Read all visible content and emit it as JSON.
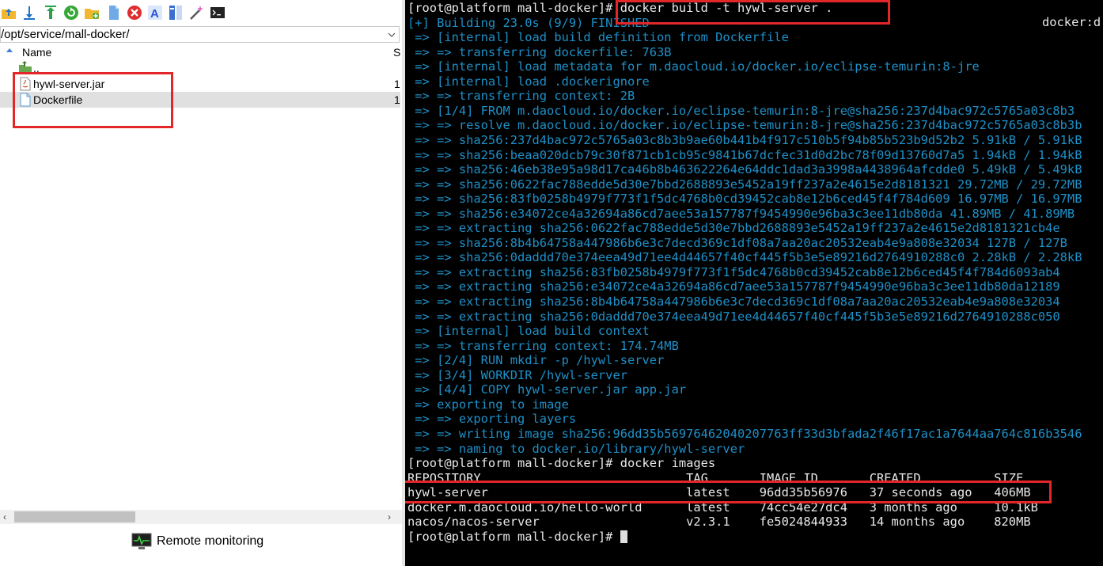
{
  "toolbar": {
    "icons": [
      "folder-up-icon",
      "download-icon",
      "upload-icon",
      "refresh-icon",
      "new-folder-icon",
      "new-file-icon",
      "delete-icon",
      "rename-icon",
      "properties-icon",
      "magic-wand-icon",
      "terminal-icon"
    ]
  },
  "file_panel": {
    "path": "/opt/service/mall-docker/",
    "columns": {
      "name": "Name",
      "size": "S"
    },
    "parent_entry": "..",
    "files": [
      {
        "name": "hywl-server.jar",
        "size": "1"
      },
      {
        "name": "Dockerfile",
        "size": "1"
      }
    ],
    "remote_monitoring_label": "Remote monitoring"
  },
  "terminal": {
    "top_right": "docker:d",
    "lines": [
      {
        "text": "[root@platform mall-docker]# docker build -t hywl-server .",
        "style": "w"
      },
      {
        "text": "[+] Building 23.0s (9/9) FINISHED",
        "style": "b"
      },
      {
        "text": " => [internal] load build definition from Dockerfile",
        "style": "b"
      },
      {
        "text": " => => transferring dockerfile: 763B",
        "style": "b"
      },
      {
        "text": " => [internal] load metadata for m.daocloud.io/docker.io/eclipse-temurin:8-jre",
        "style": "b"
      },
      {
        "text": " => [internal] load .dockerignore",
        "style": "b"
      },
      {
        "text": " => => transferring context: 2B",
        "style": "b"
      },
      {
        "text": " => [1/4] FROM m.daocloud.io/docker.io/eclipse-temurin:8-jre@sha256:237d4bac972c5765a03c8b3",
        "style": "b"
      },
      {
        "text": " => => resolve m.daocloud.io/docker.io/eclipse-temurin:8-jre@sha256:237d4bac972c5765a03c8b3b",
        "style": "b"
      },
      {
        "text": " => => sha256:237d4bac972c5765a03c8b3b9ae60b441b4f917c510b5f94b85b523b9d52b2 5.91kB / 5.91kB",
        "style": "b"
      },
      {
        "text": " => => sha256:beaa020dcb79c30f871cb1cb95c9841b67dcfec31d0d2bc78f09d13760d7a5 1.94kB / 1.94kB",
        "style": "b"
      },
      {
        "text": " => => sha256:46eb38e95a98d17ca46b8b463622264e64ddc1dad3a3998a4438964afcdde0 5.49kB / 5.49kB",
        "style": "b"
      },
      {
        "text": " => => sha256:0622fac788edde5d30e7bbd2688893e5452a19ff237a2e4615e2d8181321 29.72MB / 29.72MB",
        "style": "b"
      },
      {
        "text": " => => sha256:83fb0258b4979f773f1f5dc4768b0cd39452cab8e12b6ced45f4f784d609 16.97MB / 16.97MB",
        "style": "b"
      },
      {
        "text": " => => sha256:e34072ce4a32694a86cd7aee53a157787f9454990e96ba3c3ee11db80da 41.89MB / 41.89MB",
        "style": "b"
      },
      {
        "text": " => => extracting sha256:0622fac788edde5d30e7bbd2688893e5452a19ff237a2e4615e2d8181321cb4e",
        "style": "b"
      },
      {
        "text": " => => sha256:8b4b64758a447986b6e3c7decd369c1df08a7aa20ac20532eab4e9a808e32034 127B / 127B",
        "style": "b"
      },
      {
        "text": " => => sha256:0daddd70e374eea49d71ee4d44657f40cf445f5b3e5e89216d2764910288c0 2.28kB / 2.28kB",
        "style": "b"
      },
      {
        "text": " => => extracting sha256:83fb0258b4979f773f1f5dc4768b0cd39452cab8e12b6ced45f4f784d6093ab4",
        "style": "b"
      },
      {
        "text": " => => extracting sha256:e34072ce4a32694a86cd7aee53a157787f9454990e96ba3c3ee11db80da12189",
        "style": "b"
      },
      {
        "text": " => => extracting sha256:8b4b64758a447986b6e3c7decd369c1df08a7aa20ac20532eab4e9a808e32034",
        "style": "b"
      },
      {
        "text": " => => extracting sha256:0daddd70e374eea49d71ee4d44657f40cf445f5b3e5e89216d2764910288c050",
        "style": "b"
      },
      {
        "text": " => [internal] load build context",
        "style": "b"
      },
      {
        "text": " => => transferring context: 174.74MB",
        "style": "b"
      },
      {
        "text": " => [2/4] RUN mkdir -p /hywl-server",
        "style": "b"
      },
      {
        "text": " => [3/4] WORKDIR /hywl-server",
        "style": "b"
      },
      {
        "text": " => [4/4] COPY hywl-server.jar app.jar",
        "style": "b"
      },
      {
        "text": " => exporting to image",
        "style": "b"
      },
      {
        "text": " => => exporting layers",
        "style": "b"
      },
      {
        "text": " => => writing image sha256:96dd35b56976462040207763ff33d3bfada2f46f17ac1a7644aa764c816b3546",
        "style": "b"
      },
      {
        "text": " => => naming to docker.io/library/hywl-server",
        "style": "b"
      },
      {
        "text": "[root@platform mall-docker]# docker images",
        "style": "w"
      },
      {
        "text": "REPOSITORY                            TAG       IMAGE ID       CREATED          SIZE",
        "style": "w"
      },
      {
        "text": "hywl-server                           latest    96dd35b56976   37 seconds ago   406MB",
        "style": "w"
      },
      {
        "text": "docker.m.daocloud.io/hello-world      latest    74cc54e27dc4   3 months ago     10.1kB",
        "style": "w"
      },
      {
        "text": "nacos/nacos-server                    v2.3.1    fe5024844933   14 months ago    820MB",
        "style": "w"
      },
      {
        "text": "[root@platform mall-docker]# ",
        "style": "p"
      }
    ]
  },
  "colors": {
    "highlight_red": "#e3262a",
    "terminal_blue": "#1e90c8",
    "terminal_bg": "#000000"
  }
}
